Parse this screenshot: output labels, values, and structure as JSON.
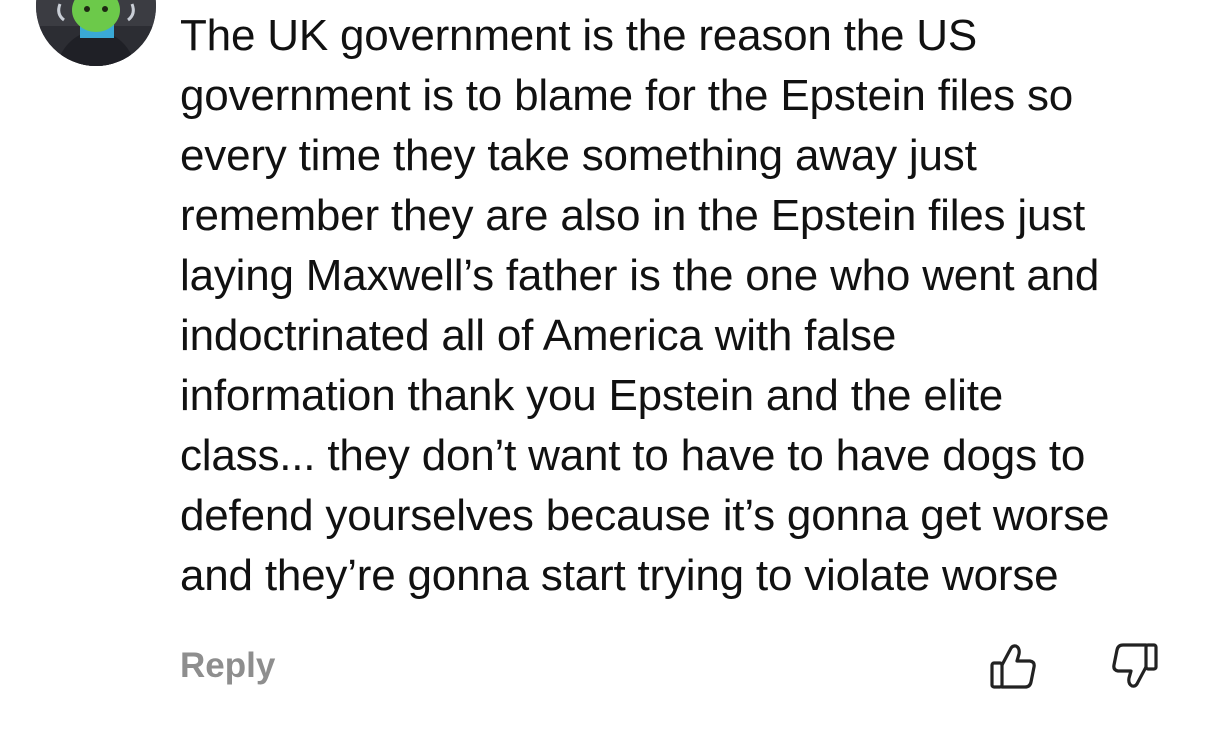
{
  "comment": {
    "avatar_icon": "user-avatar-green-face",
    "text": "The UK government is the reason the US\ngovernment is to blame for the Epstein files so\nevery time they take something away just\nremember they are also in the Epstein files just\nlaying Maxwell’s father is the one who went and\nindoctrinated all of America with false\ninformation thank you Epstein and the elite\nclass... they don’t want to have to have dogs to\ndefend yourselves because it’s gonna get worse\nand they’re gonna start trying to violate worse"
  },
  "actions": {
    "reply_label": "Reply",
    "like_icon": "thumbs-up-icon",
    "dislike_icon": "thumbs-down-icon"
  },
  "colors": {
    "text": "#111111",
    "secondary": "#8e8e8e",
    "icon": "#222222"
  }
}
